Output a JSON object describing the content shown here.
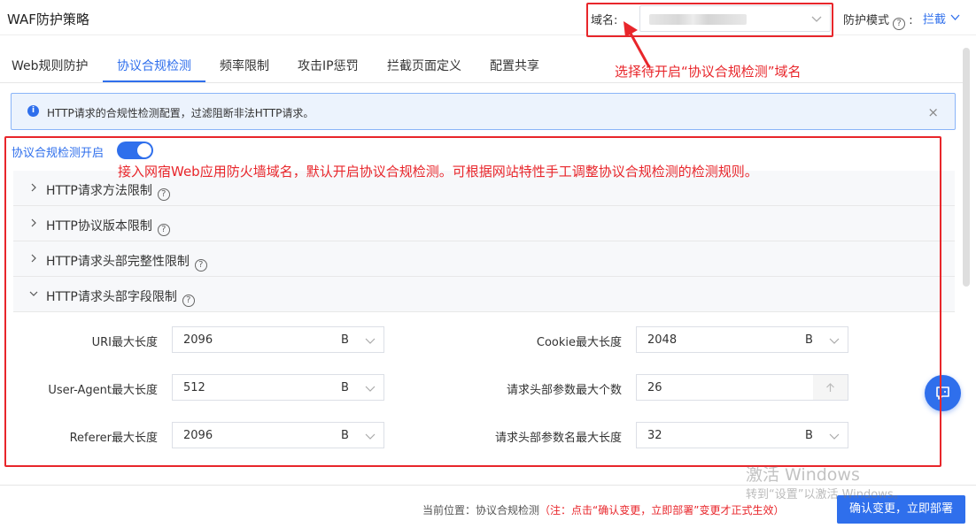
{
  "header": {
    "title": "WAF防护策略",
    "domain_label": "域名:",
    "mode_label": "防护模式",
    "mode_value": "拦截"
  },
  "annotations": {
    "domain_hint": "选择待开启“协议合规检测”域名",
    "toggle_hint": "接入网宿Web应用防火墙域名，默认开启协议合规检测。可根据网站特性手工调整协议合规检测的检测规则。"
  },
  "tabs": [
    {
      "label": "Web规则防护"
    },
    {
      "label": "协议合规检测",
      "active": true
    },
    {
      "label": "频率限制"
    },
    {
      "label": "攻击IP惩罚"
    },
    {
      "label": "拦截页面定义"
    },
    {
      "label": "配置共享"
    }
  ],
  "info": {
    "text": "HTTP请求的合规性检测配置，过滤阻断非法HTTP请求。",
    "close": "×"
  },
  "toggle": {
    "label": "协议合规检测开启",
    "on": true
  },
  "panels": [
    {
      "label": "HTTP请求方法限制",
      "expanded": false
    },
    {
      "label": "HTTP协议版本限制",
      "expanded": false
    },
    {
      "label": "HTTP请求头部完整性限制",
      "expanded": false
    },
    {
      "label": "HTTP请求头部字段限制",
      "expanded": true
    }
  ],
  "form": {
    "uri_label": "URI最大长度",
    "uri_value": "2096",
    "uri_unit": "B",
    "cookie_label": "Cookie最大长度",
    "cookie_value": "2048",
    "cookie_unit": "B",
    "ua_label": "User-Agent最大长度",
    "ua_value": "512",
    "ua_unit": "B",
    "header_count_label": "请求头部参数最大个数",
    "header_count_value": "26",
    "referer_label": "Referer最大长度",
    "referer_value": "2096",
    "referer_unit": "B",
    "header_name_label": "请求头部参数名最大长度",
    "header_name_value": "32",
    "header_name_unit": "B"
  },
  "footer": {
    "position": "当前位置：协议合规检测",
    "note": "（注：点击“确认变更，立即部署”变更才正式生效）",
    "confirm": "确认变更，立即部署"
  },
  "watermark": {
    "line1": "激活 Windows",
    "line2": "转到“设置”以激活 Windows。"
  },
  "colors": {
    "accent": "#2f6fec",
    "annotation": "#e8262b"
  }
}
